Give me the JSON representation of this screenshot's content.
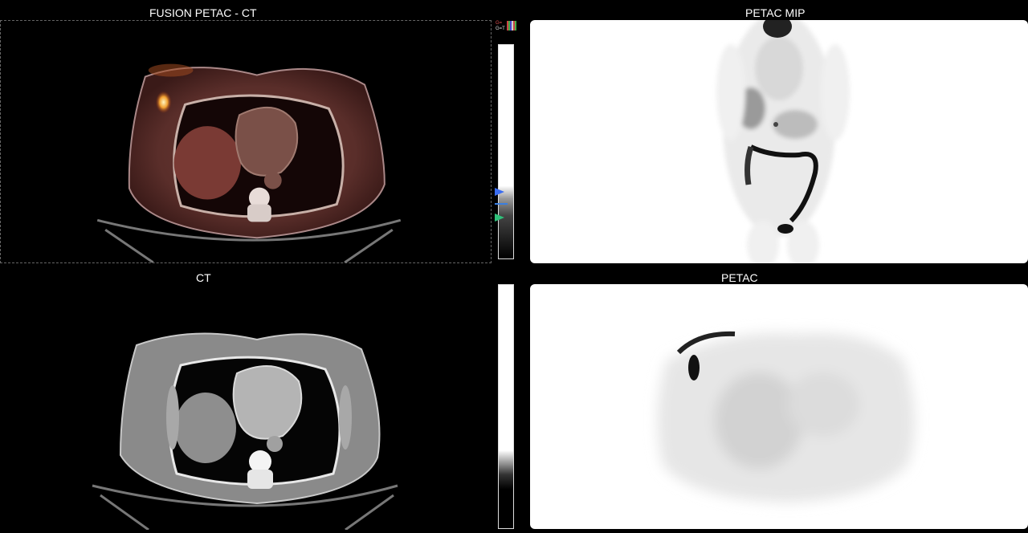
{
  "panels": {
    "fusion": {
      "title": "FUSION PETAC - CT"
    },
    "mip": {
      "title": "PETAC  MIP"
    },
    "ct": {
      "title": "CT"
    },
    "pet": {
      "title": "PETAC"
    }
  },
  "colormap_indicator": {
    "line1": "G=",
    "line2": "G=T"
  },
  "icons": {
    "window_level_marker_upper": "triangle-right-blue",
    "window_level_marker_lower": "triangle-right-green",
    "colormap_swatch": "color-grid-icon"
  },
  "colors": {
    "background": "#000000",
    "pet_viewport_background": "#ffffff",
    "fusion_tint": "#c84a3a",
    "marker_upper": "#3a6cf0",
    "marker_lower": "#2fc07a"
  }
}
